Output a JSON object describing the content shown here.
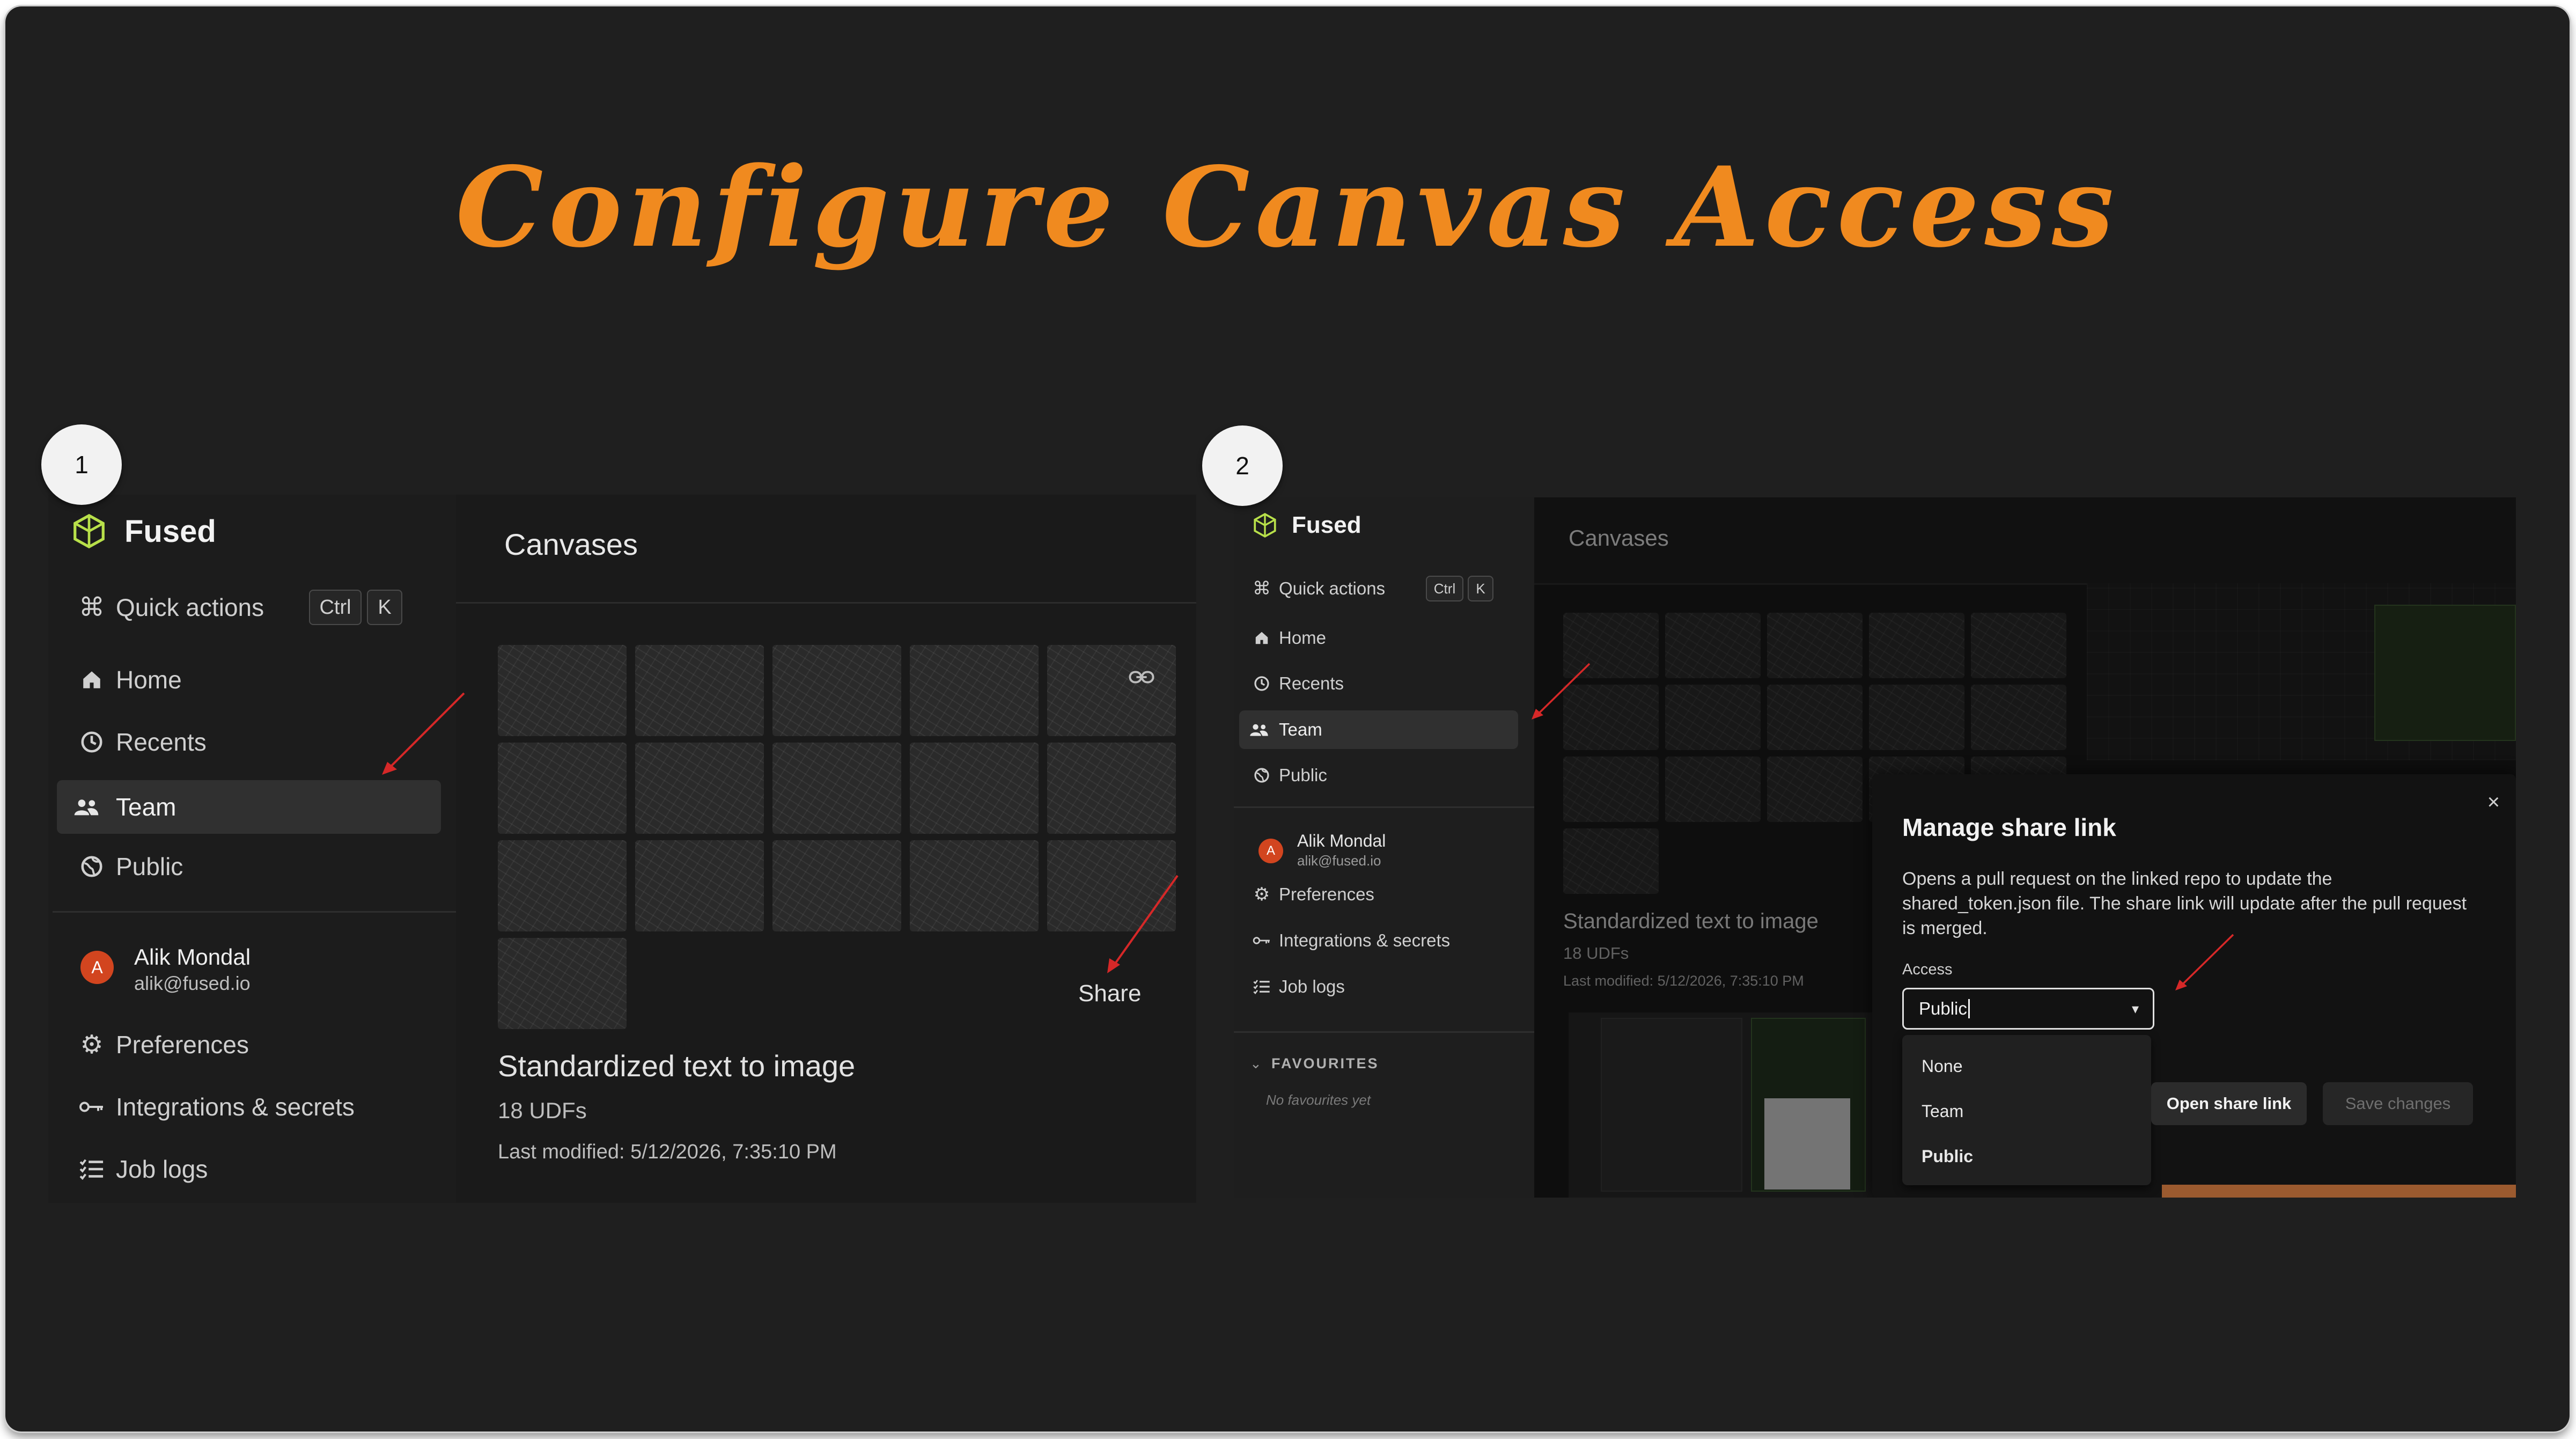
{
  "headline": "Configure Canvas Access",
  "steps": [
    "1",
    "2"
  ],
  "panel1": {
    "brand": "Fused",
    "quick_actions": {
      "label": "Quick actions",
      "keys": [
        "Ctrl",
        "K"
      ]
    },
    "nav": [
      "Home",
      "Recents",
      "Team",
      "Public"
    ],
    "active_nav": "Team",
    "user": {
      "initial": "A",
      "name": "Alik Mondal",
      "email": "alik@fused.io"
    },
    "settings": [
      "Preferences",
      "Integrations & secrets",
      "Job logs"
    ],
    "main": {
      "title": "Canvases",
      "share_label": "Share",
      "card_title": "Standardized text to image",
      "card_udfs": "18 UDFs",
      "card_modified": "Last modified: 5/12/2026, 7:35:10 PM"
    }
  },
  "panel2": {
    "brand": "Fused",
    "quick_actions": {
      "label": "Quick actions",
      "keys": [
        "Ctrl",
        "K"
      ]
    },
    "nav": [
      "Home",
      "Recents",
      "Team",
      "Public"
    ],
    "active_nav": "Team",
    "user": {
      "initial": "A",
      "name": "Alik Mondal",
      "email": "alik@fused.io"
    },
    "settings": [
      "Preferences",
      "Integrations & secrets",
      "Job logs"
    ],
    "favourites_heading": "FAVOURITES",
    "favourites_empty": "No favourites yet",
    "main": {
      "title": "Canvases",
      "card_title": "Standardized text to image",
      "card_udfs": "18 UDFs",
      "card_modified": "Last modified: 5/12/2026, 7:35:10 PM"
    },
    "modal": {
      "title": "Manage share link",
      "description": "Opens a pull request on the linked repo to update the shared_token.json file. The share link will update after the pull request is merged.",
      "access_label": "Access",
      "access_value": "Public",
      "options": [
        "None",
        "Team",
        "Public"
      ],
      "selected_option": "Public",
      "open_link_label": "Open share link",
      "save_label": "Save changes"
    }
  },
  "colors": {
    "accent": "#f08a1f",
    "background": "#1f1f1f",
    "avatar": "#d2451f",
    "arrow": "#d62828"
  }
}
